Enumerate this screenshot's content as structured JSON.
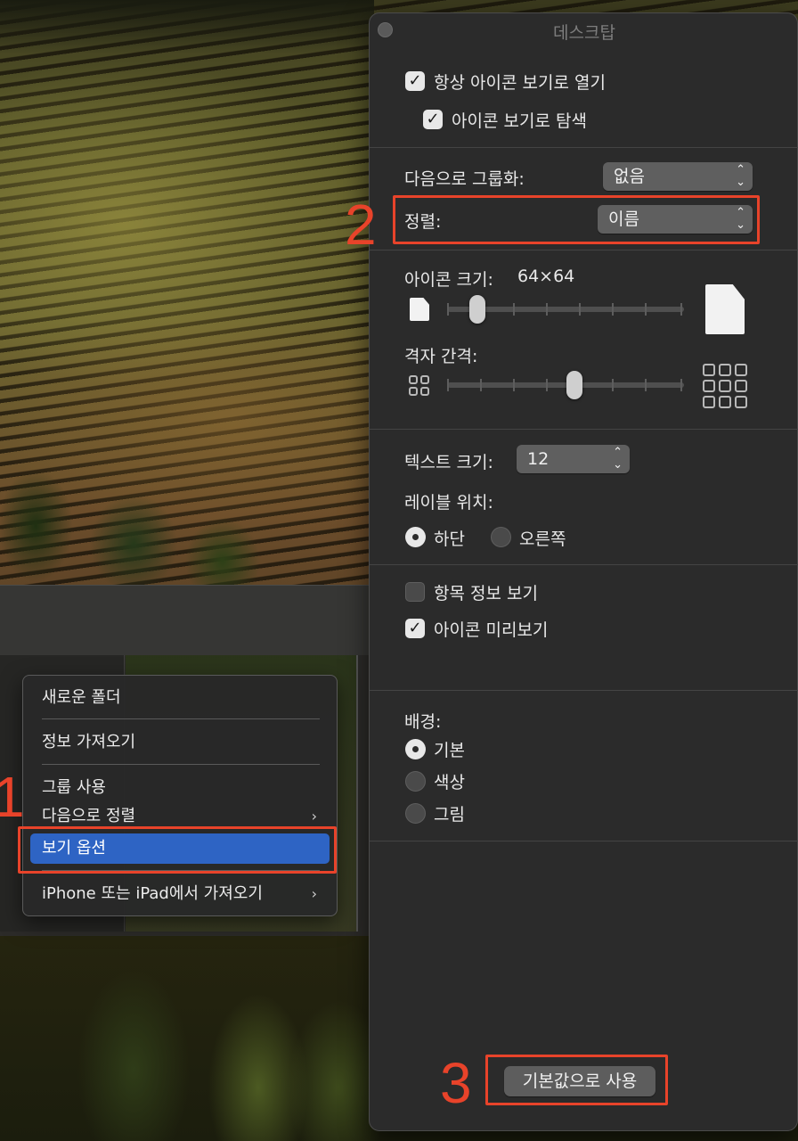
{
  "context_menu": {
    "items": [
      {
        "label": "새로운 폴더"
      },
      {
        "label": "정보 가져오기"
      },
      {
        "label": "그룹 사용"
      },
      {
        "label": "다음으로 정렬",
        "submenu_glyph": "›"
      },
      {
        "label": "보기 옵션"
      },
      {
        "label": "iPhone 또는 iPad에서 가져오기",
        "submenu_glyph": "›"
      }
    ],
    "selected_item": "보기 옵션",
    "highlight_color": "#2e64c4"
  },
  "callouts": {
    "step1": "1",
    "step2": "2",
    "step3": "3",
    "color": "#e8432a"
  },
  "panel": {
    "title": "데스크탑",
    "always_open_icon_view": {
      "label": "항상 아이콘 보기로 열기",
      "checked": true,
      "glyph": "✓"
    },
    "browse_icon_view": {
      "label": "아이콘 보기로 탐색",
      "checked": true,
      "glyph": "✓"
    },
    "group_by": {
      "label": "다음으로 그룹화:",
      "value": "없음"
    },
    "sort_by": {
      "label": "정렬:",
      "value": "이름"
    },
    "icon_size": {
      "label": "아이콘 크기:",
      "value": "64×64",
      "slider_fraction": 0.1
    },
    "grid_spacing": {
      "label": "격자 간격:",
      "slider_fraction": 0.54
    },
    "text_size": {
      "label": "텍스트 크기:",
      "value": "12"
    },
    "label_position": {
      "label": "레이블 위치:",
      "options": [
        {
          "label": "하단",
          "selected": true
        },
        {
          "label": "오른쪽",
          "selected": false
        }
      ]
    },
    "show_item_info": {
      "label": "항목 정보 보기",
      "checked": false
    },
    "show_icon_preview": {
      "label": "아이콘 미리보기",
      "checked": true,
      "glyph": "✓"
    },
    "background": {
      "label": "배경:",
      "options": [
        {
          "label": "기본",
          "selected": true
        },
        {
          "label": "색상",
          "selected": false
        },
        {
          "label": "그림",
          "selected": false
        }
      ]
    },
    "use_as_defaults_button": "기본값으로 사용",
    "updown_glyph_up": "⌃",
    "updown_glyph_down": "⌄"
  }
}
